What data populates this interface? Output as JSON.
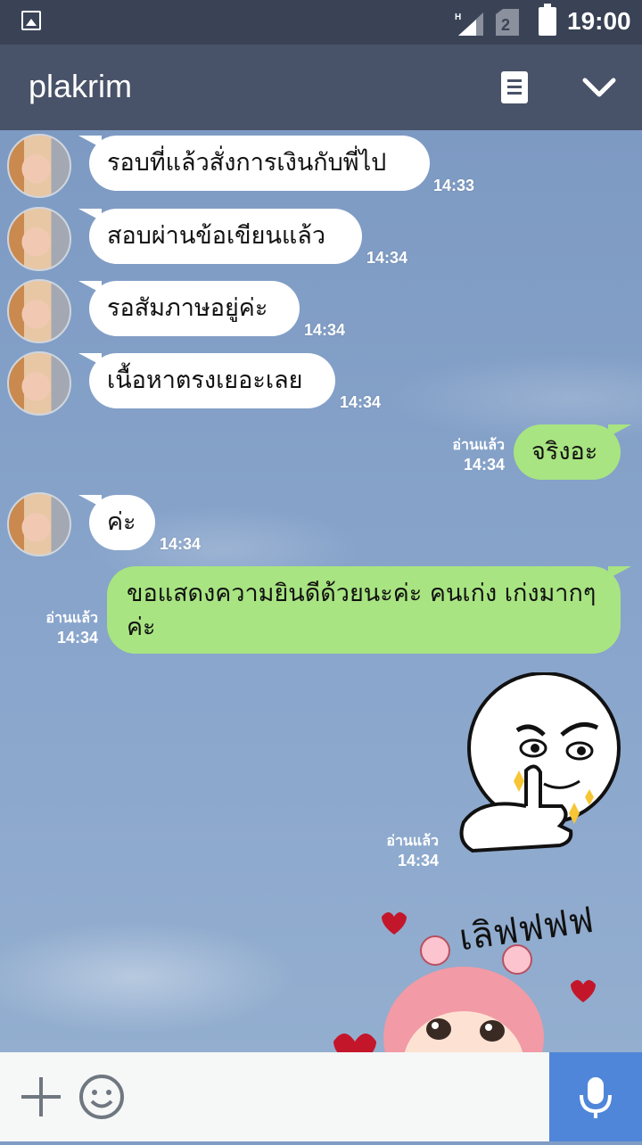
{
  "status": {
    "time": "19:00",
    "network": "H"
  },
  "header": {
    "title": "plakrim"
  },
  "messages": {
    "m1": {
      "text": "รอบที่แล้วสั่งการเงินกับพี่ไป",
      "time": "14:33"
    },
    "m2": {
      "text": "สอบผ่านข้อเขียนแล้ว",
      "time": "14:34"
    },
    "m3": {
      "text": "รอสัมภาษอยู่ค่ะ",
      "time": "14:34"
    },
    "m4": {
      "text": "เนื้อหาตรงเยอะเลย",
      "time": "14:34"
    },
    "m5": {
      "text": "จริงอะ",
      "time": "14:34",
      "read": "อ่านแล้ว"
    },
    "m6": {
      "text": "ค่ะ",
      "time": "14:34"
    },
    "m7": {
      "text": "ขอแสดงความยินดีด้วยนะค่ะ คนเก่ง เก่งมากๆ ค่ะ",
      "time": "14:34",
      "read": "อ่านแล้ว"
    },
    "m8": {
      "time": "14:34",
      "read": "อ่านแล้ว"
    },
    "m9": {
      "sticker_text": "เลิฟฟฟฟ"
    }
  },
  "colors": {
    "header": "#485268",
    "incoming": "#ffffff",
    "outgoing": "#a8e481",
    "send": "#4f86d9"
  }
}
